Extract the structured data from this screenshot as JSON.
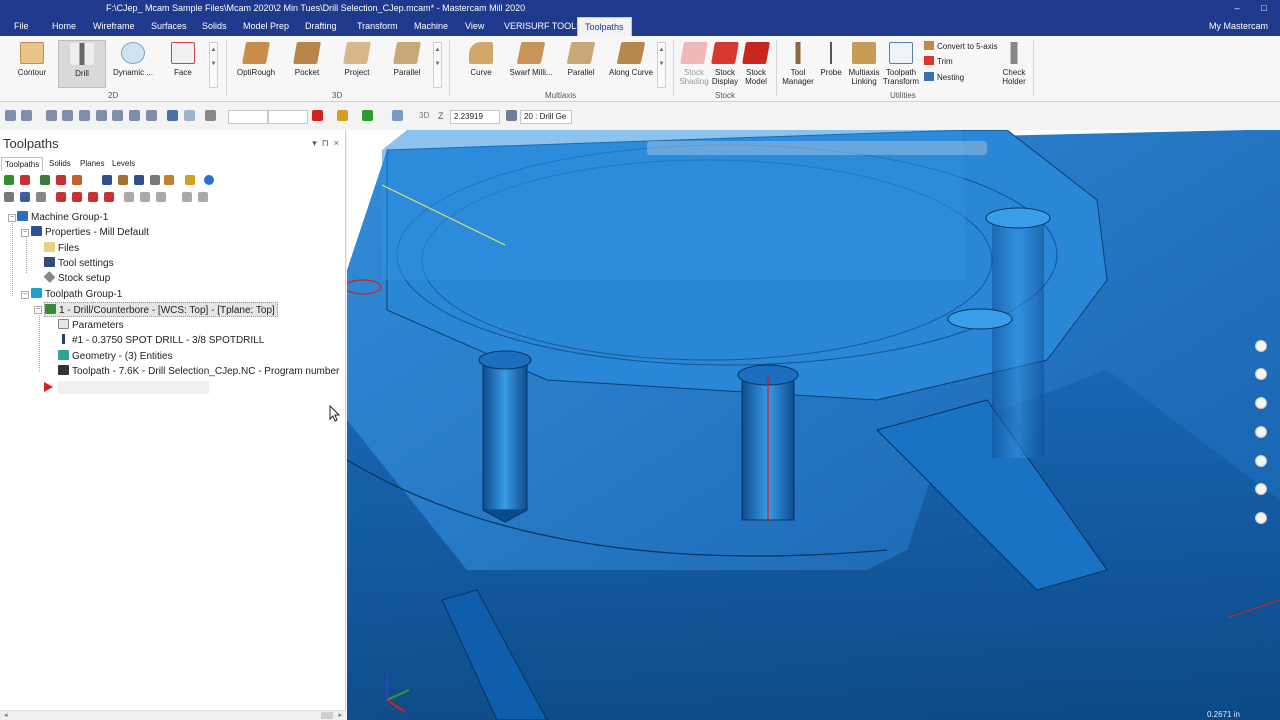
{
  "window": {
    "title": "F:\\CJep_ Mcam Sample Files\\Mcam 2020\\2 Min Tues\\Drill Selection_CJep.mcam* - Mastercam Mill 2020",
    "minimize": "–",
    "maximize": "□"
  },
  "menu": {
    "tabs": [
      "File",
      "Home",
      "Wireframe",
      "Surfaces",
      "Solids",
      "Model Prep",
      "Drafting",
      "Transform",
      "Machine",
      "View",
      "VERISURF TOOLS",
      "Toolpaths"
    ],
    "active": "Toolpaths",
    "user": "My Mastercam"
  },
  "ribbon": {
    "group_2d": {
      "label": "2D",
      "buttons": [
        "Contour",
        "Drill",
        "Dynamic ...",
        "Face"
      ]
    },
    "group_3d": {
      "label": "3D",
      "buttons": [
        "OptiRough",
        "Pocket",
        "Project",
        "Parallel"
      ]
    },
    "group_multiaxis": {
      "label": "Multiaxis",
      "buttons": [
        "Curve",
        "Swarf Milli...",
        "Parallel",
        "Along Curve"
      ]
    },
    "group_stock": {
      "label": "Stock",
      "buttons": [
        {
          "l1": "Stock",
          "l2": "Shading"
        },
        {
          "l1": "Stock",
          "l2": "Display"
        },
        {
          "l1": "Stock",
          "l2": "Model"
        }
      ]
    },
    "group_utilities": {
      "label": "Utilities",
      "buttons": [
        {
          "l1": "Tool",
          "l2": "Manager"
        },
        {
          "l1": "Probe",
          "l2": ""
        },
        {
          "l1": "Multiaxis",
          "l2": "Linking"
        },
        {
          "l1": "Toolpath",
          "l2": "Transform"
        }
      ],
      "small": [
        "Convert to 5-axis",
        "Trim",
        "Nesting"
      ],
      "check": {
        "l1": "Check",
        "l2": "Holder"
      }
    }
  },
  "quick_access": {
    "z_label": "Z",
    "z_value": "2.23919",
    "level_value": "20 : Drill Ge",
    "dim_label": "3D"
  },
  "manager": {
    "title": "Toolpaths",
    "tabs": [
      "Toolpaths",
      "Solids",
      "Planes",
      "Levels"
    ],
    "tree": {
      "machine_group": "Machine Group-1",
      "properties": "Properties - Mill Default",
      "files": "Files",
      "tool_settings": "Tool settings",
      "stock_setup": "Stock setup",
      "toolpath_group": "Toolpath Group-1",
      "operation": "1 - Drill/Counterbore - [WCS: Top] - [Tplane: Top]",
      "parameters": "Parameters",
      "tool": "#1 - 0.3750 SPOT DRILL - 3/8 SPOTDRILL",
      "geometry": "Geometry - (3) Entities",
      "toolpath": "Toolpath - 7.6K - Drill Selection_CJep.NC - Program number"
    }
  },
  "viewport": {
    "model_color": "#1a78c8",
    "scale_text": "0.2671 in"
  },
  "colors": {
    "titlebar": "#1f3a8c",
    "accent_red": "#d42020"
  }
}
